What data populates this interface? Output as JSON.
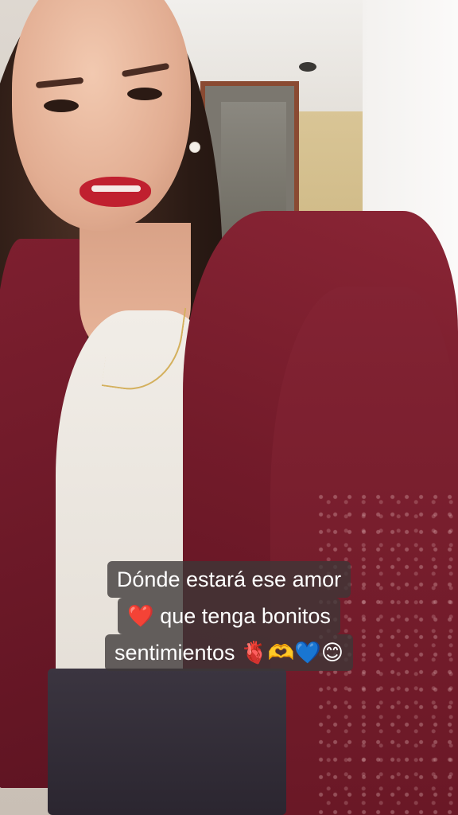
{
  "caption": {
    "line1": "Dónde estará ese amor",
    "line2": "❤️ que tenga bonitos",
    "line3": "sentimientos 🫀🫶💙😊"
  },
  "colors": {
    "cardigan": "#7a1d2c",
    "caption_bg": "#3c3737",
    "caption_text": "#ffffff"
  }
}
